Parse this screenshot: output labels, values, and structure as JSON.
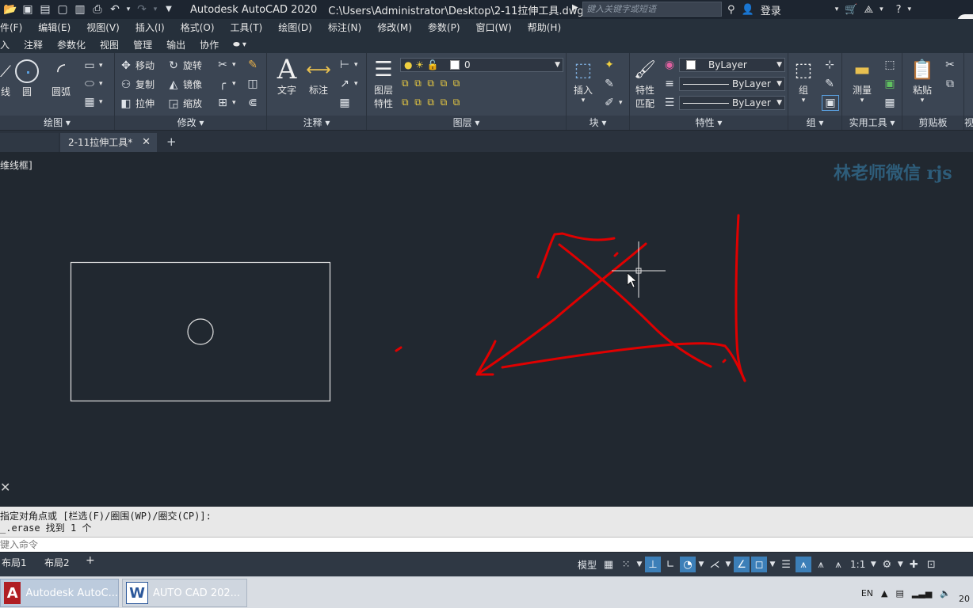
{
  "titlebar": {
    "app_title": "Autodesk AutoCAD 2020",
    "file_path": "C:\\Users\\Administrator\\Desktop\\2-11拉伸工具.dwg",
    "search_placeholder": "键入关键字或短语",
    "login_label": "登录"
  },
  "menu": {
    "items": [
      "件(F)",
      "编辑(E)",
      "视图(V)",
      "插入(I)",
      "格式(O)",
      "工具(T)",
      "绘图(D)",
      "标注(N)",
      "修改(M)",
      "参数(P)",
      "窗口(W)",
      "帮助(H)"
    ]
  },
  "ribbon_tabs": {
    "items": [
      "入",
      "注释",
      "参数化",
      "视图",
      "管理",
      "输出",
      "协作"
    ]
  },
  "ribbon": {
    "draw": {
      "title": "绘图",
      "line": "线",
      "circle": "圆",
      "arc": "圆弧"
    },
    "modify": {
      "title": "修改",
      "move": "移动",
      "rotate": "旋转",
      "copy": "复制",
      "mirror": "镜像",
      "stretch": "拉伸",
      "scale": "缩放"
    },
    "annotation": {
      "title": "注释",
      "text": "文字",
      "dimension": "标注"
    },
    "layers": {
      "title": "图层",
      "layer_props_1": "图层",
      "layer_props_2": "特性",
      "current_layer": "0"
    },
    "block": {
      "title": "块",
      "insert": "插入"
    },
    "properties": {
      "title": "特性",
      "match_1": "特性",
      "match_2": "匹配",
      "color": "ByLayer",
      "linetype": "ByLayer",
      "lineweight": "ByLayer"
    },
    "group": {
      "title": "组",
      "group": "组"
    },
    "utilities": {
      "title": "实用工具",
      "measure": "测量"
    },
    "clipboard": {
      "title": "剪贴板",
      "paste": "粘贴"
    },
    "cut_title": "视"
  },
  "filetabs": {
    "active_tab": "2-11拉伸工具*"
  },
  "drawing": {
    "view_label": "维线框]",
    "watermark": "林老师微信 rjs",
    "colors": {
      "background": "#212830",
      "geometry": "#e0e0e0",
      "markup": "#e00000"
    }
  },
  "command": {
    "history": [
      "指定对角点或 [栏选(F)/圈围(WP)/圈交(CP)]:",
      "_.erase 找到 1 个"
    ],
    "input_placeholder": "键入命令"
  },
  "layouts": {
    "tabs": [
      "布局1",
      "布局2"
    ]
  },
  "status": {
    "model_label": "模型",
    "scale_label": "1:1"
  },
  "taskbar": {
    "task1": "Autodesk AutoC...",
    "task2": "AUTO  CAD 202...",
    "lang": "EN",
    "clock": "20"
  }
}
